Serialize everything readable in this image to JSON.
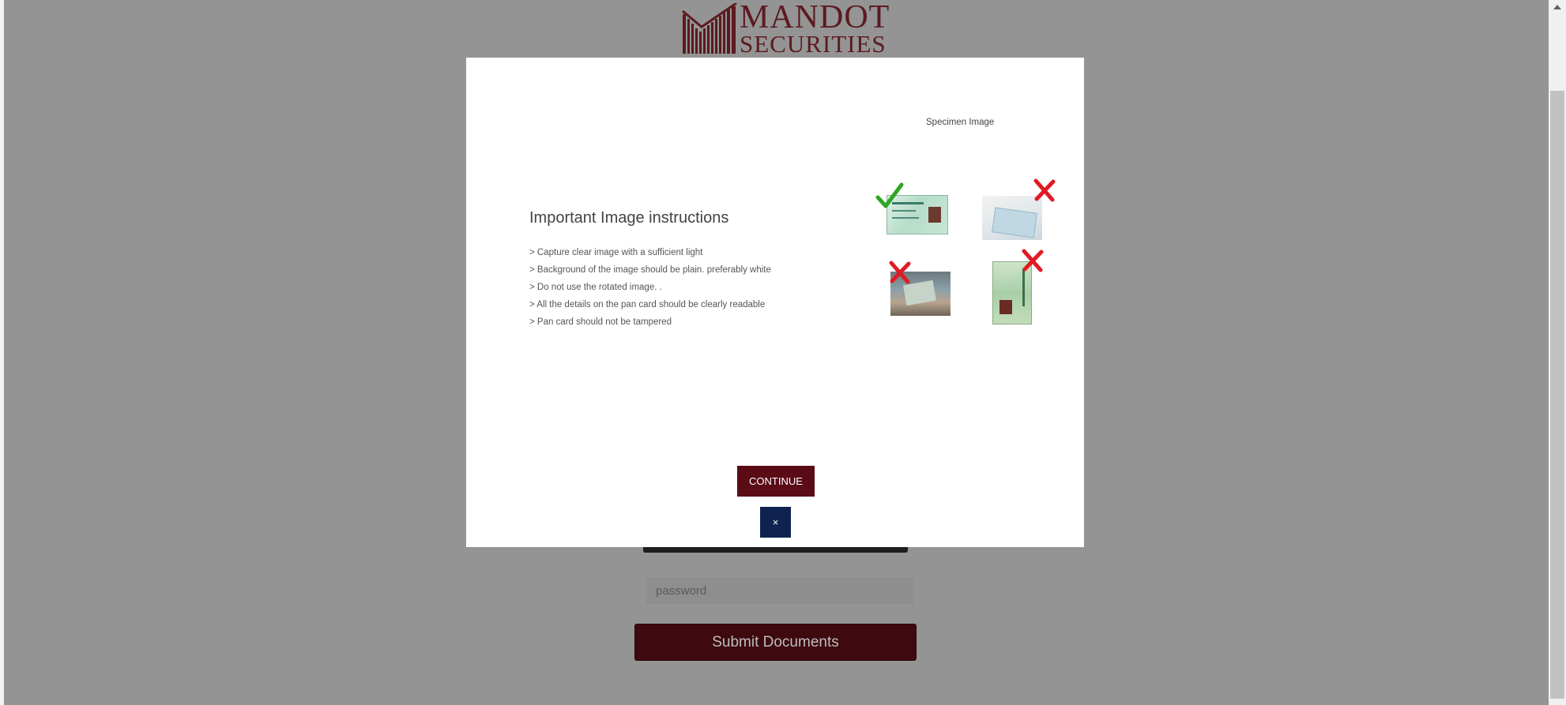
{
  "brand": {
    "line1": "MANDOT",
    "line2": "SECURITIES",
    "color": "#5c1a1f",
    "icon": "bar-chart-logo-icon"
  },
  "form": {
    "password_placeholder": "password",
    "submit_label": "Submit Documents"
  },
  "modal": {
    "title": "Important Image instructions",
    "instructions": [
      "> Capture clear image with a sufficient light",
      "> Background of the image should be plain. preferably white",
      "> Do not use the rotated image. .",
      ">  All the details on the pan card should be clearly readable",
      "> Pan card should not be tampered"
    ],
    "specimen_title": "Specimen Image",
    "specimens": [
      {
        "verdict": "correct",
        "icon": "checkmark-icon"
      },
      {
        "verdict": "incorrect",
        "icon": "cross-icon"
      },
      {
        "verdict": "incorrect",
        "icon": "cross-icon"
      },
      {
        "verdict": "incorrect",
        "icon": "cross-icon"
      }
    ],
    "continue_label": "CONTINUE",
    "close_label": "×"
  },
  "colors": {
    "overlay": "#949494",
    "continue_button": "#5a0b16",
    "close_button": "#0f2350",
    "submit_button": "#3f0910",
    "check": "#2fa523",
    "cross": "#e01b24"
  }
}
